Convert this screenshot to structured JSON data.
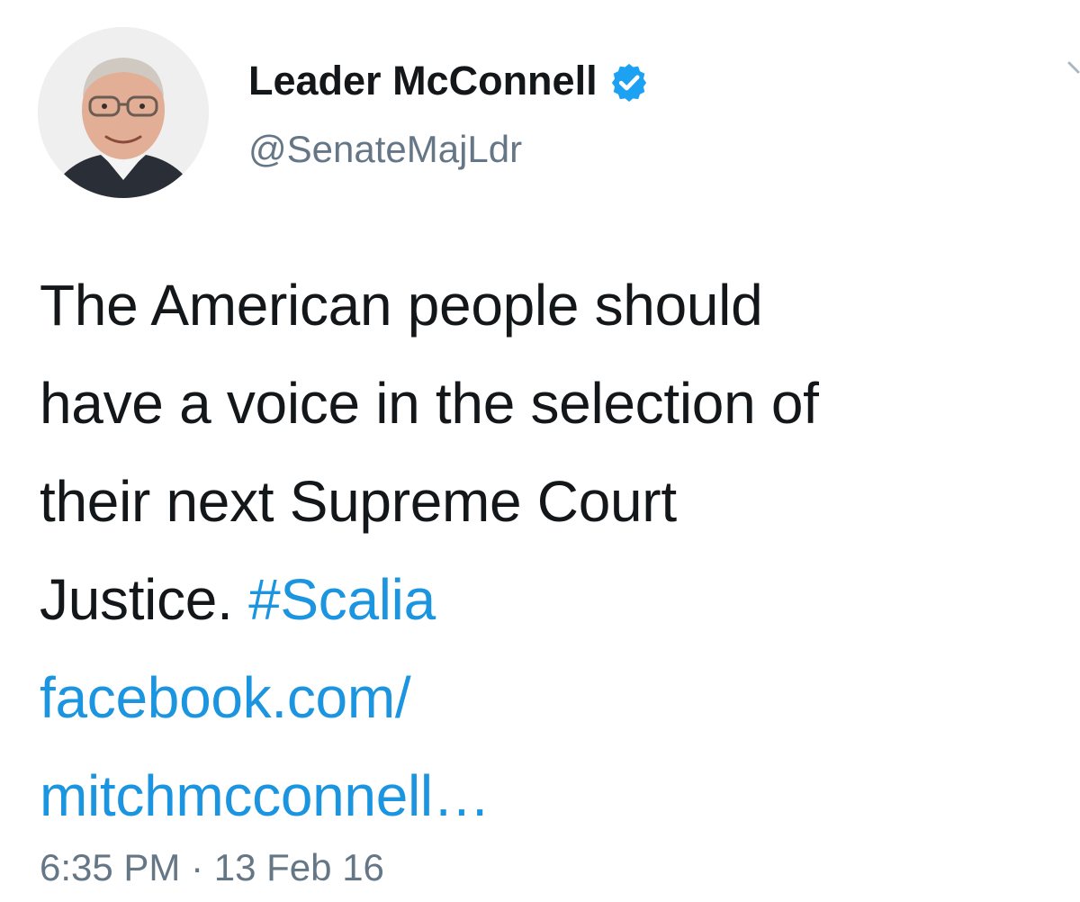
{
  "tweet": {
    "display_name": "Leader McConnell",
    "handle": "@SenateMajLdr",
    "verified_icon": "verified-badge-icon",
    "caret_icon": "chevron-down-icon",
    "text_lines": [
      "The American people should",
      "have a voice in the selection of",
      "their next Supreme Court",
      "Justice."
    ],
    "hashtag": "#Scalia",
    "link_lines": [
      "facebook.com/",
      "mitchmcconnell…"
    ],
    "time": "6:35 PM",
    "separator": "·",
    "date": "13 Feb 16",
    "colors": {
      "link": "#1b95e0",
      "verified": "#1da1f2",
      "secondary_text": "#657786",
      "primary_text": "#14171a"
    }
  }
}
